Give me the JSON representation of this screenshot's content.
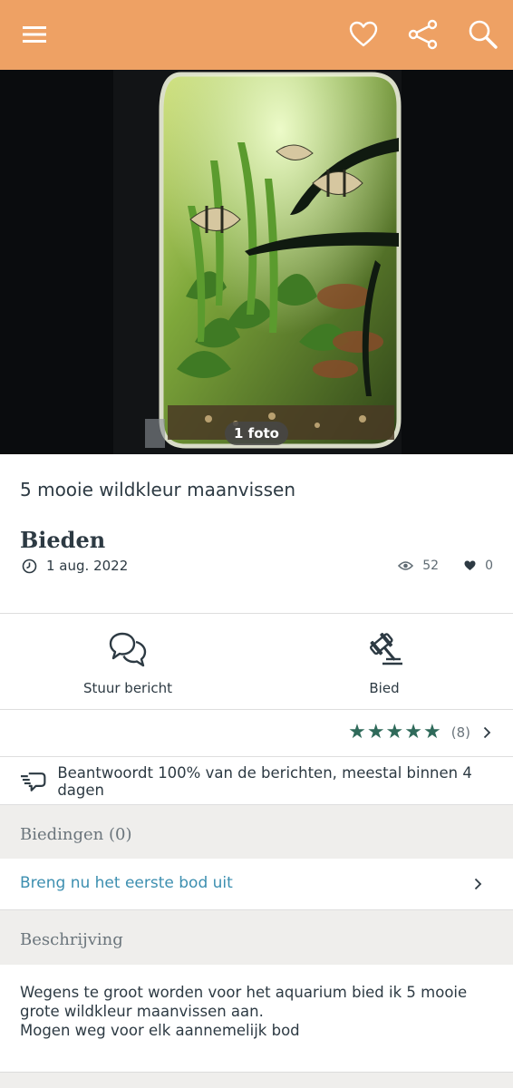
{
  "toolbar": {
    "menu_icon": "hamburger-menu-icon",
    "favorite_icon": "heart-outline-icon",
    "share_icon": "share-icon",
    "search_icon": "search-icon"
  },
  "photo": {
    "count_label": "1 foto"
  },
  "listing": {
    "title": "5 mooie wildkleur maanvissen",
    "price": "Bieden",
    "date": "1 aug. 2022",
    "views": "52",
    "favorites": "0"
  },
  "actions": {
    "message_label": "Stuur bericht",
    "bid_label": "Bied"
  },
  "seller": {
    "rating_stars": 5,
    "rating_count": "(8)",
    "response_text": "Beantwoordt 100% van de berichten, meestal binnen 4 dagen"
  },
  "bids": {
    "header": "Biedingen (0)",
    "first_bid_link": "Breng nu het eerste bod uit"
  },
  "description": {
    "header": "Beschrijving",
    "lines": [
      "Wegens te groot worden voor het aquarium bied ik 5 mooie",
      "grote wildkleur maanvissen aan.",
      "Mogen weg voor elk aannemelijk bod"
    ]
  },
  "colors": {
    "toolbar": "#eea164",
    "star": "#2f6a5a",
    "link": "#3d8fb0",
    "text": "#2d3a43"
  }
}
